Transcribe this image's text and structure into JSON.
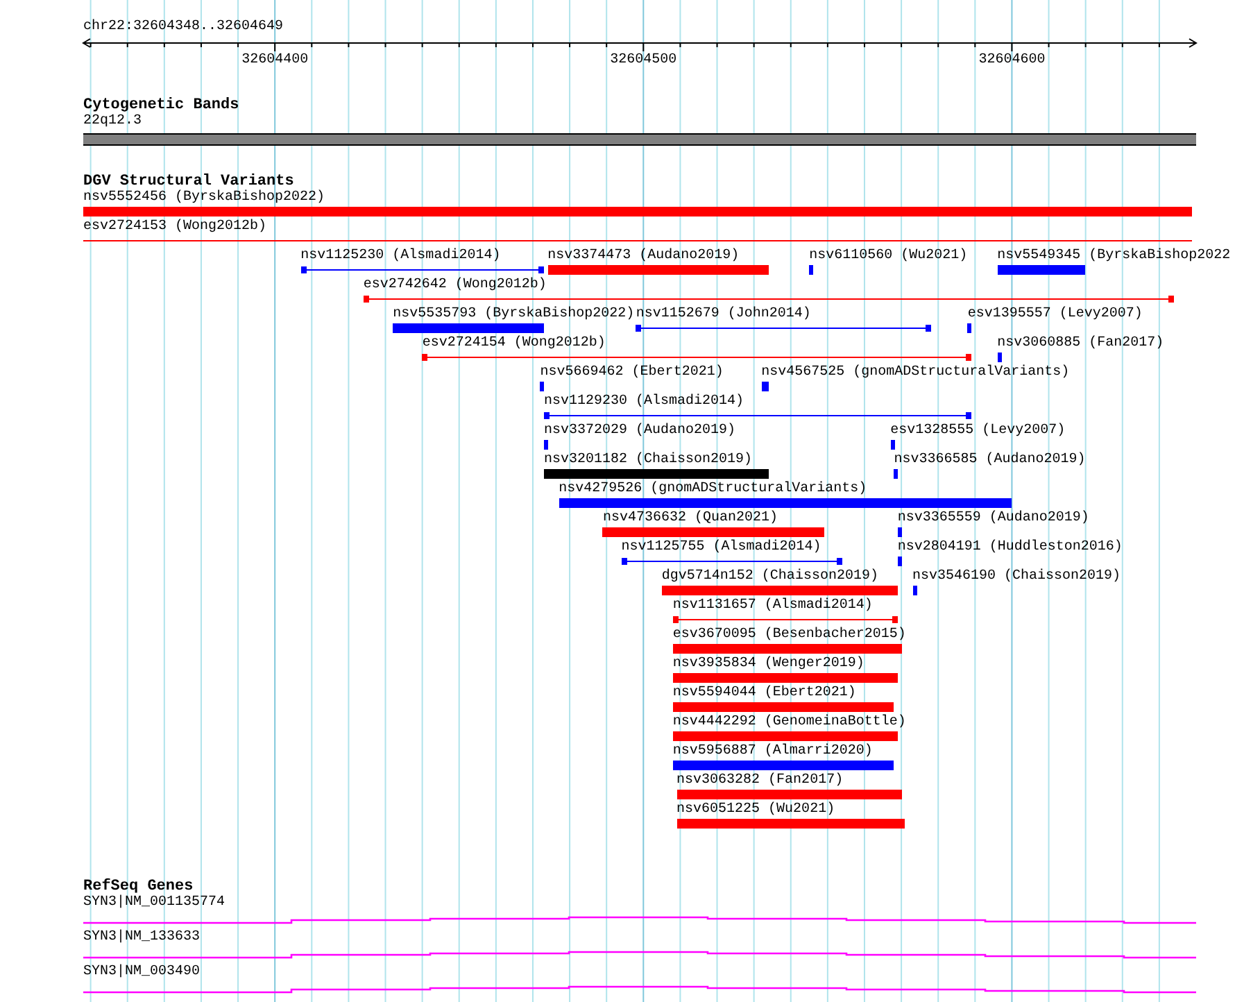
{
  "ruler": {
    "title": "chr22:32604348..32604649",
    "ticks": [
      {
        "label": "32604400"
      },
      {
        "label": "32604500"
      },
      {
        "label": "32604600"
      }
    ]
  },
  "cytobands": {
    "title": "Cytogenetic Bands",
    "band": "22q12.3"
  },
  "variants": {
    "title": "DGV Structural Variants",
    "lanes": [
      [
        {
          "name": "nsv5552456 (ByrskaBishop2022)",
          "kind": "bar",
          "color": "#ff0000"
        }
      ],
      [
        {
          "name": "esv2724153 (Wong2012b)",
          "kind": "span",
          "color": "#ff0000"
        }
      ],
      [
        {
          "name": "nsv1125230 (Alsmadi2014)",
          "kind": "line",
          "color": "#0000ff"
        },
        {
          "name": "nsv3374473 (Audano2019)",
          "kind": "bar",
          "color": "#ff0000"
        },
        {
          "name": "nsv6110560 (Wu2021)",
          "kind": "bar",
          "color": "#0000ff"
        },
        {
          "name": "nsv5549345 (ByrskaBishop2022",
          "kind": "bar",
          "color": "#0000ff"
        }
      ],
      [
        {
          "name": "esv2742642 (Wong2012b)",
          "kind": "line",
          "color": "#ff0000"
        }
      ],
      [
        {
          "name": "nsv5535793 (ByrskaBishop2022)",
          "kind": "bar",
          "color": "#0000ff"
        },
        {
          "name": "nsv1152679 (John2014)",
          "kind": "line",
          "color": "#0000ff"
        },
        {
          "name": "esv1395557 (Levy2007)",
          "kind": "bar",
          "color": "#0000ff"
        }
      ],
      [
        {
          "name": "esv2724154 (Wong2012b)",
          "kind": "line",
          "color": "#ff0000"
        },
        {
          "name": "nsv3060885 (Fan2017)",
          "kind": "bar",
          "color": "#0000ff"
        }
      ],
      [
        {
          "name": "nsv5669462 (Ebert2021)",
          "kind": "bar",
          "color": "#0000ff"
        },
        {
          "name": "nsv4567525 (gnomADStructuralVariants)",
          "kind": "bar",
          "color": "#0000ff"
        }
      ],
      [
        {
          "name": "nsv1129230 (Alsmadi2014)",
          "kind": "line",
          "color": "#0000ff"
        }
      ],
      [
        {
          "name": "nsv3372029 (Audano2019)",
          "kind": "bar",
          "color": "#0000ff"
        },
        {
          "name": "esv1328555 (Levy2007)",
          "kind": "bar",
          "color": "#0000ff"
        }
      ],
      [
        {
          "name": "nsv3201182 (Chaisson2019)",
          "kind": "bar",
          "color": "#000000"
        },
        {
          "name": "nsv3366585 (Audano2019)",
          "kind": "bar",
          "color": "#0000ff"
        }
      ],
      [
        {
          "name": "nsv4279526 (gnomADStructuralVariants)",
          "kind": "bar",
          "color": "#0000ff"
        }
      ],
      [
        {
          "name": "nsv4736632 (Quan2021)",
          "kind": "bar",
          "color": "#ff0000"
        },
        {
          "name": "nsv3365559 (Audano2019)",
          "kind": "bar",
          "color": "#0000ff"
        }
      ],
      [
        {
          "name": "nsv1125755 (Alsmadi2014)",
          "kind": "line",
          "color": "#0000ff"
        },
        {
          "name": "nsv2804191 (Huddleston2016)",
          "kind": "bar",
          "color": "#0000ff"
        }
      ],
      [
        {
          "name": "dgv5714n152 (Chaisson2019)",
          "kind": "bar",
          "color": "#ff0000"
        },
        {
          "name": "nsv3546190 (Chaisson2019)",
          "kind": "bar",
          "color": "#0000ff"
        }
      ],
      [
        {
          "name": "nsv1131657 (Alsmadi2014)",
          "kind": "line",
          "color": "#ff0000"
        }
      ],
      [
        {
          "name": "esv3670095 (Besenbacher2015)",
          "kind": "bar",
          "color": "#ff0000"
        }
      ],
      [
        {
          "name": "nsv3935834 (Wenger2019)",
          "kind": "bar",
          "color": "#ff0000"
        }
      ],
      [
        {
          "name": "nsv5594044 (Ebert2021)",
          "kind": "bar",
          "color": "#ff0000"
        }
      ],
      [
        {
          "name": "nsv4442292 (GenomeinaBottle)",
          "kind": "bar",
          "color": "#ff0000"
        }
      ],
      [
        {
          "name": "nsv5956887 (Almarri2020)",
          "kind": "bar",
          "color": "#0000ff"
        }
      ],
      [
        {
          "name": "nsv3063282 (Fan2017)",
          "kind": "bar",
          "color": "#ff0000"
        }
      ],
      [
        {
          "name": "nsv6051225 (Wu2021)",
          "kind": "bar",
          "color": "#ff0000"
        }
      ]
    ]
  },
  "genes": {
    "title": "RefSeq Genes",
    "items": [
      {
        "name": "SYN3|NM_001135774"
      },
      {
        "name": "SYN3|NM_133633"
      },
      {
        "name": "SYN3|NM_003490"
      }
    ]
  }
}
